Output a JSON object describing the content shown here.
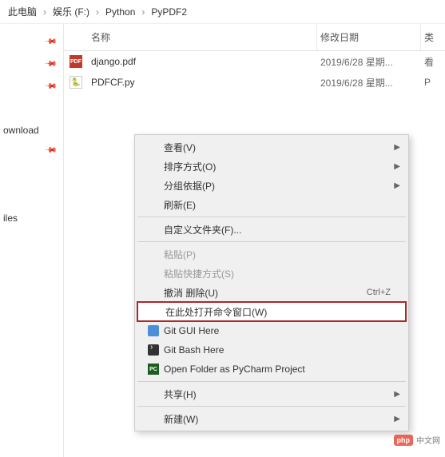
{
  "breadcrumb": {
    "items": [
      "此电脑",
      "娱乐 (F:)",
      "Python",
      "PyPDF2"
    ]
  },
  "columns": {
    "name": "名称",
    "date": "修改日期",
    "type": "类"
  },
  "files": [
    {
      "icon": "pdf",
      "name": "django.pdf",
      "date": "2019/6/28 星期...",
      "type": "看"
    },
    {
      "icon": "py",
      "name": "PDFCF.py",
      "date": "2019/6/28 星期...",
      "type": "P"
    }
  ],
  "sidebar": {
    "items": [
      "ownload",
      "iles"
    ]
  },
  "menu": {
    "view": "查看(V)",
    "sort": "排序方式(O)",
    "group": "分组依据(P)",
    "refresh": "刷新(E)",
    "customize": "自定义文件夹(F)...",
    "paste": "粘贴(P)",
    "paste_shortcut": "粘贴快捷方式(S)",
    "undo_delete": "撤消 删除(U)",
    "undo_shortcut": "Ctrl+Z",
    "open_cmd": "在此处打开命令窗口(W)",
    "git_gui": "Git GUI Here",
    "git_bash": "Git Bash Here",
    "pycharm": "Open Folder as PyCharm Project",
    "share": "共享(H)",
    "new": "新建(W)"
  },
  "watermark": {
    "badge": "php",
    "text": "中文网"
  }
}
